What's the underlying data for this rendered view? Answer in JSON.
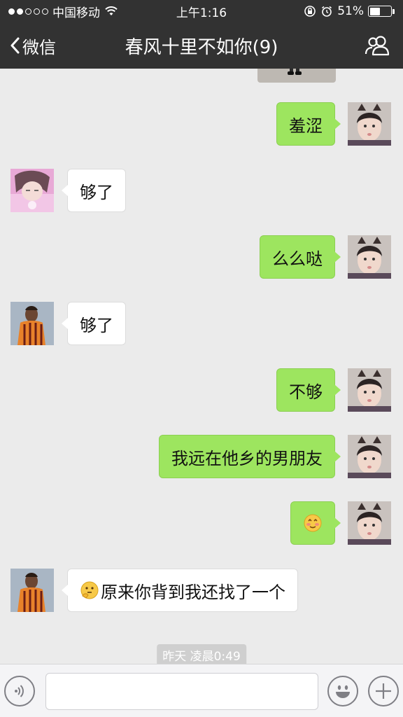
{
  "status_bar": {
    "carrier": "中国移动",
    "time": "上午1:16",
    "battery_percent": "51%",
    "battery_level": 0.51
  },
  "nav": {
    "back_label": "微信",
    "title": "春风十里不如你(9)",
    "contacts_icon": "group-icon"
  },
  "messages": [
    {
      "side": "right",
      "text": "羞涩",
      "avatar": "girl-cat-ears"
    },
    {
      "side": "left",
      "text": "够了",
      "avatar": "pink-girl"
    },
    {
      "side": "right",
      "text": "么么哒",
      "avatar": "girl-cat-ears"
    },
    {
      "side": "left",
      "text": "够了",
      "avatar": "soccer-player"
    },
    {
      "side": "right",
      "text": "不够",
      "avatar": "girl-cat-ears"
    },
    {
      "side": "right",
      "text": "我远在他乡的男朋友",
      "avatar": "girl-cat-ears"
    },
    {
      "side": "right",
      "text": "",
      "emoji": "shy-smile-emoji",
      "avatar": "girl-cat-ears"
    },
    {
      "side": "left",
      "text": "原来你背到我还找了一个",
      "emoji": "thinking-emoji",
      "avatar": "soccer-player"
    }
  ],
  "timestamp": "昨天 凌晨0:49",
  "input_bar": {
    "voice_icon": "voice-icon",
    "emoji_icon": "emoji-icon",
    "plus_icon": "plus-icon",
    "text_value": ""
  },
  "colors": {
    "header": "#323232",
    "background": "#ebebeb",
    "bubble_sent": "#9de55f",
    "bubble_received": "#ffffff"
  }
}
